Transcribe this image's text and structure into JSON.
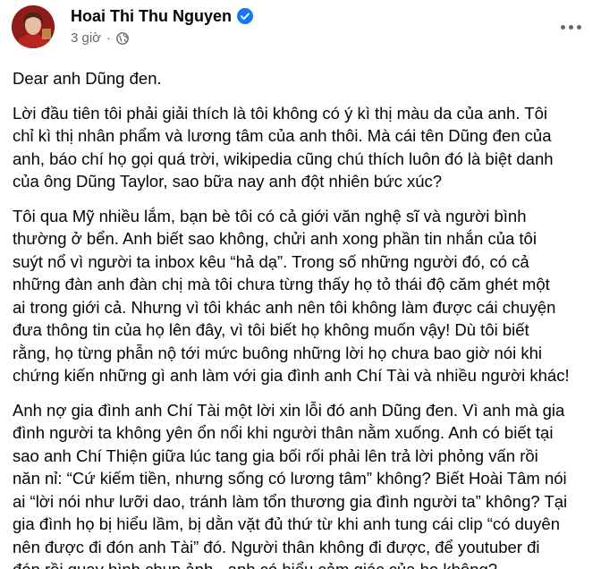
{
  "post": {
    "author": "Hoai Thi Thu Nguyen",
    "timestamp": "3 giờ",
    "separator": "·",
    "audience_icon": "globe-icon",
    "verified_icon": "verified-badge-icon",
    "more_icon": "more-options-icon",
    "accent_color": "#1877f2",
    "paragraphs": [
      {
        "lines": [
          "Dear anh Dũng đen."
        ]
      },
      {
        "lines": [
          "Lời đầu tiên tôi phải giải thích là tôi không có ý kì thị màu da của anh. Tôi",
          "chỉ kì thị nhân phẩm và lương tâm của anh thôi. Mà cái tên Dũng đen của",
          "anh, báo chí họ gọi quá trời, wikipedia cũng chú thích luôn đó là biệt danh",
          "của ông Dũng Taylor, sao bữa nay anh đột nhiên bức xúc?"
        ]
      },
      {
        "lines": [
          "Tôi qua Mỹ nhiều lắm, bạn bè tôi có cả giới văn nghệ sĩ và người bình",
          "thường ở bển. Anh biết sao không, chửi anh xong phần tin nhắn của tôi",
          "suýt nổ vì người ta inbox kêu “hả dạ”. Trong số những người đó, có cả",
          "những đàn anh đàn chị mà tôi chưa từng thấy họ tỏ thái độ căm ghét một",
          "ai trong giới cả. Nhưng vì tôi khác anh nên tôi không làm được cái chuyện",
          "đưa thông tin của họ lên đây, vì tôi biết họ không muốn vậy! Dù tôi biết",
          "rằng, họ từng phẫn nộ tới mức buông những lời họ chưa bao giờ nói khi",
          "chứng kiến những gì anh làm với gia đình anh Chí Tài và nhiều người khác!"
        ]
      },
      {
        "lines": [
          "Anh nợ gia đình anh Chí Tài một lời xin lỗi đó anh Dũng đen. Vì anh mà gia",
          "đình người ta không yên ổn nổi khi người thân nằm xuống. Anh có biết tại",
          "sao anh Chí Thiện giữa lúc tang gia bối rối phải lên trả lời phỏng vấn rồi",
          "năn nỉ: “Cứ kiếm tiền, nhưng sống có lương tâm” không? Biết Hoài Tâm nói",
          "ai “lời nói như lưỡi dao, tránh làm tổn thương gia đình người ta” không? Tại",
          "gia đình họ bị hiểu lầm, bị dằn vặt đủ thứ từ khi anh tung cái clip “có duyên",
          "nên được đi đón anh Tài” đó. Người thân không đi được, để youtuber đi",
          "đón rồi quay hình chụp ảnh - anh có hiểu cảm giác của họ không?"
        ]
      }
    ]
  }
}
